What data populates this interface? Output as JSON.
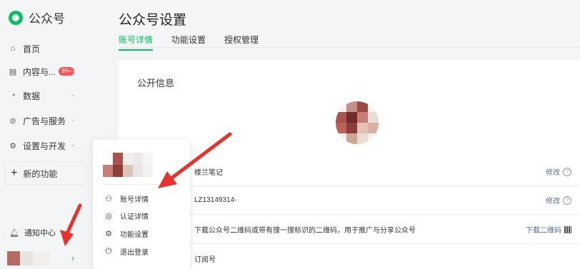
{
  "app": {
    "logo_text": "公众号"
  },
  "sidebar": {
    "items": [
      {
        "label": "首页",
        "icon": "home-icon",
        "has_chevron": false
      },
      {
        "label": "内容与...",
        "icon": "document-icon",
        "badge": "99+",
        "has_chevron": true
      },
      {
        "label": "数据",
        "icon": "chart-pie-icon",
        "has_chevron": true
      },
      {
        "label": "广告与服务",
        "icon": "compass-icon",
        "has_chevron": true
      },
      {
        "label": "设置与开发",
        "icon": "gear-icon",
        "has_chevron": true
      }
    ],
    "new_function_label": "新的功能",
    "notification_label": "通知中心"
  },
  "header": {
    "title": "公众号设置",
    "tabs": [
      {
        "label": "账号详情",
        "active": true
      },
      {
        "label": "功能设置",
        "active": false
      },
      {
        "label": "授权管理",
        "active": false
      }
    ]
  },
  "main": {
    "section_title": "公开信息",
    "rows": [
      {
        "value": "楼兰笔记",
        "action": "修改",
        "help": "?"
      },
      {
        "value": "LZ13149314-",
        "action": "修改",
        "help": "?"
      },
      {
        "value": "下载公众号二维码或带有搜一搜标识的二维码，用于推广与分享公众号",
        "action": "下载二维码"
      },
      {
        "value": "订阅号"
      }
    ]
  },
  "popup_menu": {
    "items": [
      {
        "label": "账号详情",
        "icon": "user-icon"
      },
      {
        "label": "认证详情",
        "icon": "verified-check-icon"
      },
      {
        "label": "功能设置",
        "icon": "gear-icon"
      },
      {
        "label": "退出登录",
        "icon": "power-icon"
      }
    ]
  },
  "colors": {
    "accent": "#07c160",
    "badge": "#fa5151",
    "link": "#576b95",
    "annotation_arrow": "#e8322c"
  }
}
